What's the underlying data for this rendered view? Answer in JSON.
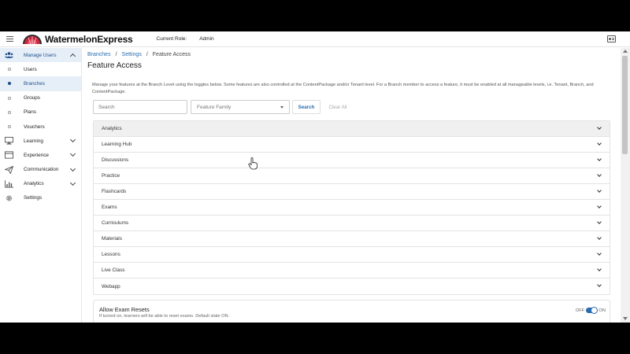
{
  "header": {
    "logo_text": "WatermelonExpress",
    "role_label": "Current Role:",
    "role_value": "Admin"
  },
  "sidebar": {
    "items": [
      {
        "label": "Manage Users",
        "icon": "users-icon"
      },
      {
        "label": "Users"
      },
      {
        "label": "Branches"
      },
      {
        "label": "Groups"
      },
      {
        "label": "Plans"
      },
      {
        "label": "Vouchers"
      },
      {
        "label": "Learning",
        "icon": "monitor-icon"
      },
      {
        "label": "Experience",
        "icon": "window-icon"
      },
      {
        "label": "Communication",
        "icon": "send-icon"
      },
      {
        "label": "Analytics",
        "icon": "chart-icon"
      },
      {
        "label": "Settings",
        "icon": "gear-icon"
      }
    ]
  },
  "breadcrumb": {
    "items": [
      "Branches",
      "Settings",
      "Feature Access"
    ],
    "separator": "/"
  },
  "page": {
    "title": "Feature Access",
    "description": "Manage your features at the Branch Level using the toggles below. Some features are also controlled at the ContentPackage and/or Tenant level. For a Branch member to access a feature, it must be enabled at all manageable levels, i.e. Tenant, Branch, and ContentPackage."
  },
  "filters": {
    "search_placeholder": "Search",
    "family_placeholder": "Feature Family",
    "search_button": "Search",
    "clear_button": "Clear All"
  },
  "features": [
    "Analytics",
    "Learning Hub",
    "Discussions",
    "Practice",
    "Flashcards",
    "Exams",
    "Curriculums",
    "Materials",
    "Lessons",
    "Live Class",
    "Webapp"
  ],
  "reset": {
    "title": "Allow Exam Resets",
    "description": "If turned on, learners will be able to reset exams. Default state ON.",
    "off_label": "OFF",
    "on_label": "ON",
    "state": "on"
  },
  "colors": {
    "accent": "#2a6cb0",
    "active_bg": "#e6eef8",
    "logo_red": "#c8283e"
  }
}
